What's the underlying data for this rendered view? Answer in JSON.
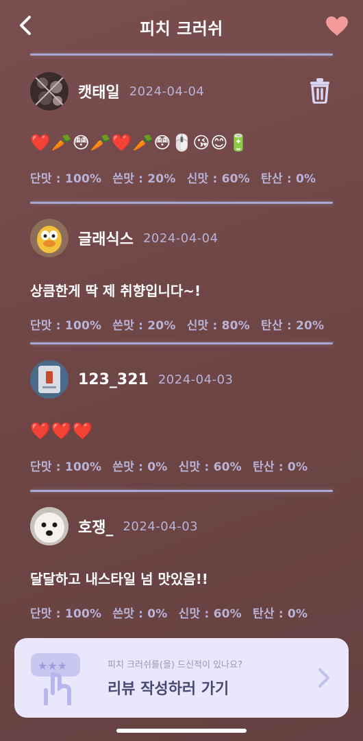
{
  "header": {
    "title": "피치 크러쉬"
  },
  "reviews": [
    {
      "nickname": "캣태일",
      "date": "2024-04-04",
      "content": "❤️🥕😳🥕❤️🥕😳🖱️😘😊🔋",
      "taste": {
        "sweet": "단맛 : 100%",
        "bitter": "쓴맛 : 20%",
        "sour": "신맛 : 60%",
        "carbonation": "탄산 : 0%"
      },
      "deletable": true
    },
    {
      "nickname": "글래식스",
      "date": "2024-04-04",
      "content": "상큼한게 딱 제 취향입니다~!",
      "taste": {
        "sweet": "단맛 : 100%",
        "bitter": "쓴맛 : 20%",
        "sour": "신맛 : 80%",
        "carbonation": "탄산 : 20%"
      }
    },
    {
      "nickname": "123_321",
      "date": "2024-04-03",
      "content": "❤️❤️❤️",
      "taste": {
        "sweet": "단맛 : 100%",
        "bitter": "쓴맛 : 0%",
        "sour": "신맛 : 60%",
        "carbonation": "탄산 : 0%"
      }
    },
    {
      "nickname": "호쟁_",
      "date": "2024-04-03",
      "content": "달달하고 내스타일 넘 맛있음!!",
      "taste": {
        "sweet": "단맛 : 100%",
        "bitter": "쓴맛 : 0%",
        "sour": "신맛 : 60%",
        "carbonation": "탄산 : 0%"
      }
    }
  ],
  "cta": {
    "subtitle": "피치 크러쉬를(을) 드신적이 있나요?",
    "label": "리뷰 작성하러 가기"
  },
  "icons": {
    "back": "chevron-left-icon",
    "favorite": "heart-icon",
    "delete": "trash-icon",
    "cta": "rating-hand-icon",
    "cta_arrow": "chevron-right-icon"
  },
  "colors": {
    "background": "#6f4646",
    "divider": "#a9a7d6",
    "muted_text": "#b9b3d8",
    "heart": "#f49a9a",
    "cta_bg": "#e9e7fb",
    "cta_text": "#4a4873"
  }
}
